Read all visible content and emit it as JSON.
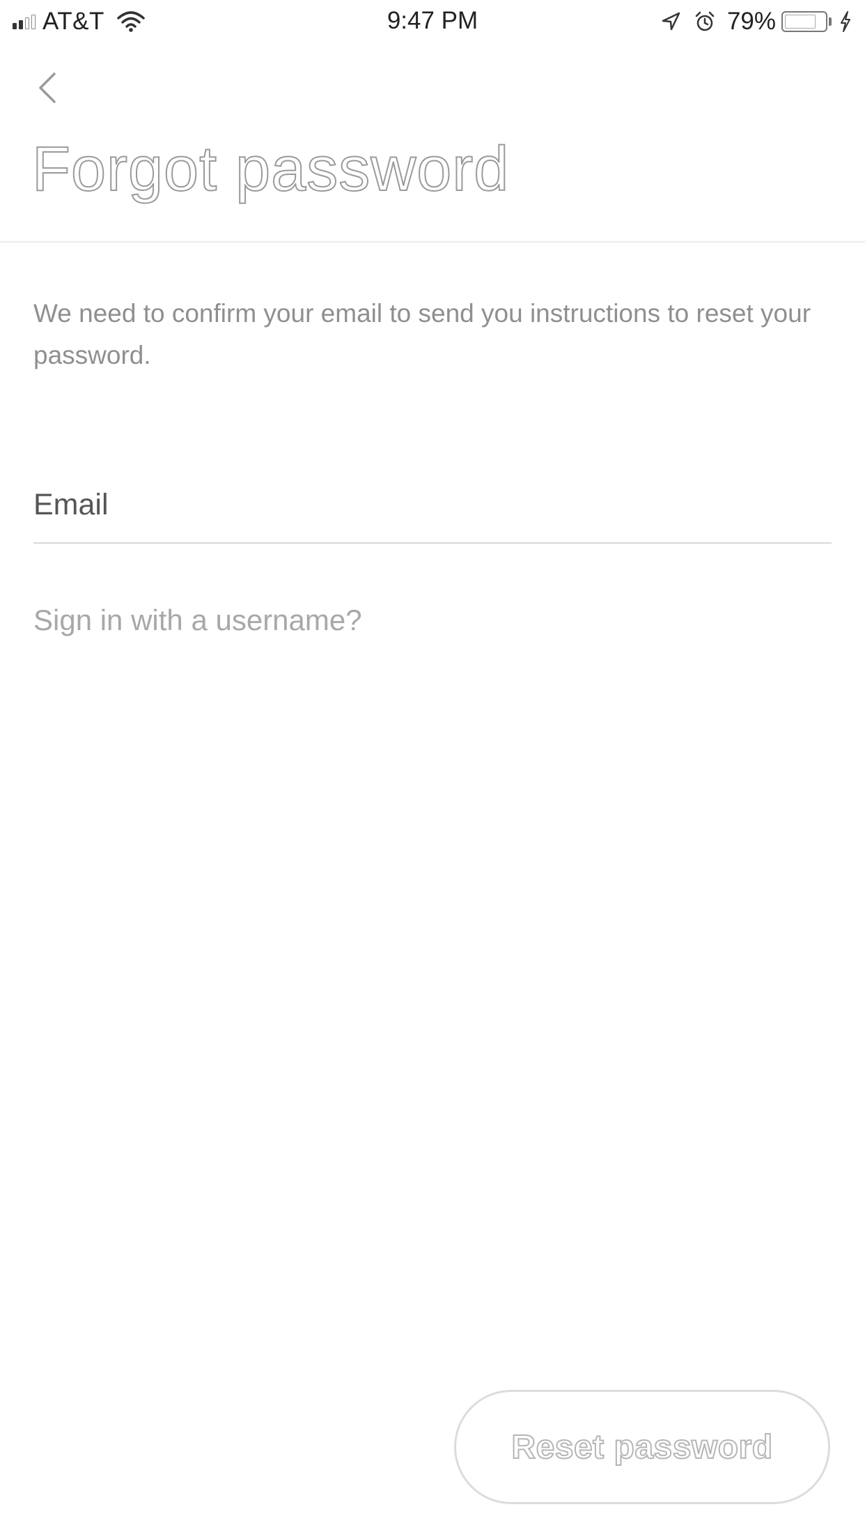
{
  "status_bar": {
    "carrier": "AT&T",
    "time": "9:47 PM",
    "battery_percent": "79%",
    "signal_strength_bars": 2,
    "signal_total_bars": 4,
    "battery_level": 0.79,
    "charging": true,
    "icons": [
      "signal-icon",
      "wifi-icon",
      "location-arrow-icon",
      "alarm-clock-icon",
      "battery-icon",
      "charging-bolt-icon"
    ]
  },
  "header": {
    "back_icon": "chevron-left-icon",
    "title": "Forgot password"
  },
  "main": {
    "instructions": "We need to confirm your email to send you instructions to reset your password.",
    "email_placeholder": "Email",
    "email_value": "",
    "username_link": "Sign in with a username?"
  },
  "footer": {
    "reset_button_label": "Reset password"
  },
  "colors": {
    "background": "#ffffff",
    "title_outline": "#9a9a9a",
    "body_text": "#8f8f8f",
    "link_text": "#a8a8a8",
    "divider": "#d8d8d8",
    "button_border": "#dcdcdc"
  }
}
